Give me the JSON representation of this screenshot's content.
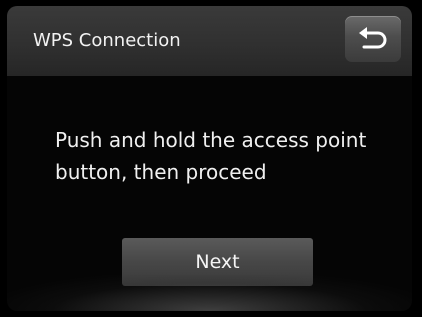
{
  "header": {
    "title": "WPS Connection",
    "back_icon": "return-arrow-icon"
  },
  "message": {
    "line1": "Push and hold the access point",
    "line2": "button, then proceed"
  },
  "actions": {
    "next_label": "Next"
  },
  "colors": {
    "background": "#000000",
    "header": "#333333",
    "button": "#4a4a4a",
    "text": "#f0f0f0"
  }
}
